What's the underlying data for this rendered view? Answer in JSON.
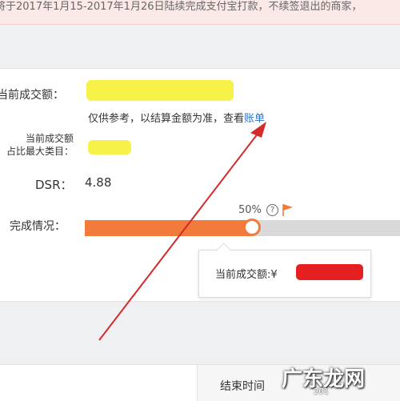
{
  "notice": {
    "text": "将于2017年1月15-2017年1月26日陆续完成支付宝打款，不续签退出的商家，"
  },
  "summary": {
    "current_amount_label": "当前成交额：",
    "hint_text": "仅供参考，以结算金额为准，查看",
    "bill_link": "账单",
    "category_label_line1": "当前成交额",
    "category_label_line2": "占比最大类目：",
    "dsr_label": "DSR：",
    "dsr_value": "4.88",
    "progress_label": "完成情况：",
    "progress_percent_text": "50%",
    "progress_fraction": 0.5
  },
  "tooltip": {
    "text": "当前成交额:¥"
  },
  "bottom": {
    "end_time_label": "结束时间"
  },
  "watermark": {
    "text": "广东龙网",
    "sub": "201"
  },
  "colors": {
    "accent": "#f27a3a",
    "link": "#2b74c6",
    "annotation": "#e62020",
    "highlight": "#f6f24a"
  }
}
